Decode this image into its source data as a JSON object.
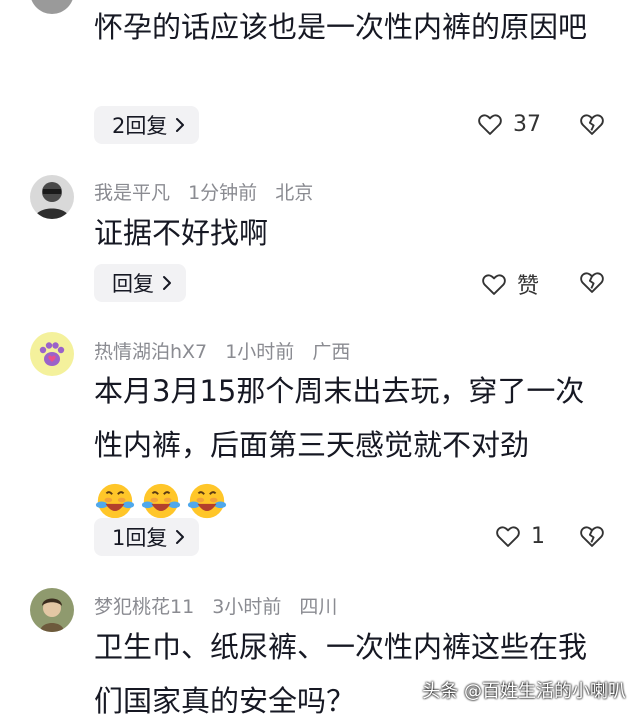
{
  "comments": [
    {
      "text": "怀孕的话应该也是一次性内裤的原因吧",
      "replies_label": "2回复",
      "likes": "37"
    },
    {
      "username": "我是平凡",
      "time": "1分钟前",
      "location": "北京",
      "text": "证据不好找啊",
      "replies_label": "回复",
      "likes": "赞"
    },
    {
      "username": "热情湖泊hX7",
      "time": "1小时前",
      "location": "广西",
      "text": "本月3月15那个周末出去玩，穿了一次性内裤，后面第三天感觉就不对劲",
      "replies_label": "1回复",
      "likes": "1"
    },
    {
      "username": "梦犯桃花11",
      "time": "3小时前",
      "location": "四川",
      "text": "卫生巾、纸尿裤、一次性内裤这些在我们国家真的安全吗？"
    }
  ],
  "watermark": "头条 @百姓生活的小喇叭"
}
